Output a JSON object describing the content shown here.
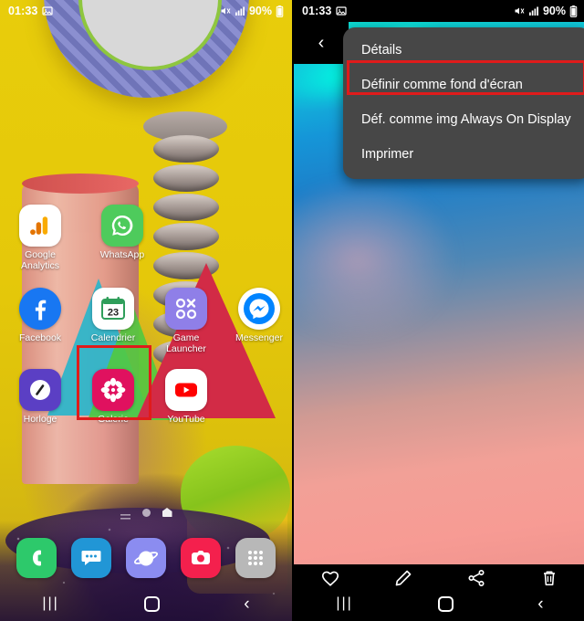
{
  "left_phone": {
    "statusbar": {
      "time": "01:33",
      "icons": [
        "image-icon",
        "mute-icon",
        "signal-icon",
        "battery-icon"
      ],
      "battery": "90%"
    },
    "home_screen": {
      "rows": [
        [
          {
            "label": "Google\nAnalytics",
            "icon": "google-analytics-icon",
            "color": "#ffffff"
          },
          {
            "label": "WhatsApp",
            "icon": "whatsapp-icon",
            "color": "#4ecb5c"
          }
        ],
        [
          {
            "label": "Facebook",
            "icon": "facebook-icon",
            "color": "#1877f2"
          },
          {
            "label": "Calendrier",
            "icon": "calendar-icon",
            "color": "#ffffff",
            "badge": "23"
          },
          {
            "label": "Game\nLauncher",
            "icon": "game-launcher-icon",
            "color": "#8f7fe8"
          },
          {
            "label": "Messenger",
            "icon": "messenger-icon",
            "color": "#ffffff"
          }
        ],
        [
          {
            "label": "Horloge",
            "icon": "clock-icon",
            "color": "#5b3fc4"
          },
          {
            "label": "Galerie",
            "icon": "gallery-icon",
            "color": "#e0115f",
            "highlighted": true
          },
          {
            "label": "YouTube",
            "icon": "youtube-icon",
            "color": "#ffffff"
          }
        ]
      ],
      "page_indicator": {
        "pages": 3,
        "current": 2
      },
      "dock": [
        {
          "label": "Phone",
          "icon": "phone-icon",
          "color": "#2dc96b"
        },
        {
          "label": "Messages",
          "icon": "messages-icon",
          "color": "#2196d6"
        },
        {
          "label": "Internet",
          "icon": "internet-icon",
          "color": "#8b8cf0"
        },
        {
          "label": "Camera",
          "icon": "camera-icon",
          "color": "#f4204d"
        },
        {
          "label": "Apps",
          "icon": "apps-grid-icon",
          "color": "#b8b8b8"
        }
      ]
    },
    "navbar": [
      {
        "label": "Recents",
        "icon": "recents-icon",
        "glyph": "|||"
      },
      {
        "label": "Home",
        "icon": "home-icon"
      },
      {
        "label": "Back",
        "icon": "back-icon",
        "glyph": "‹"
      }
    ]
  },
  "right_phone": {
    "statusbar": {
      "time": "01:33",
      "icons": [
        "image-icon",
        "mute-icon",
        "signal-icon",
        "battery-icon"
      ],
      "battery": "90%"
    },
    "back_button": {
      "icon": "back-chevron-icon",
      "glyph": "‹"
    },
    "context_menu": {
      "items": [
        {
          "label": "Détails",
          "highlighted": false
        },
        {
          "label": "Définir comme fond d'écran",
          "highlighted": true
        },
        {
          "label": "Déf. comme img Always On Display",
          "highlighted": false
        },
        {
          "label": "Imprimer",
          "highlighted": false
        }
      ],
      "highlight_color": "#e01b1b",
      "background": "#474747"
    },
    "viewer_toolbar": [
      {
        "label": "Favorite",
        "icon": "heart-icon"
      },
      {
        "label": "Edit",
        "icon": "pencil-icon"
      },
      {
        "label": "Share",
        "icon": "share-icon"
      },
      {
        "label": "Delete",
        "icon": "trash-icon"
      }
    ],
    "navbar": [
      {
        "label": "Recents",
        "icon": "recents-icon",
        "glyph": "|||"
      },
      {
        "label": "Home",
        "icon": "home-icon"
      },
      {
        "label": "Back",
        "icon": "back-icon",
        "glyph": "‹"
      }
    ]
  }
}
